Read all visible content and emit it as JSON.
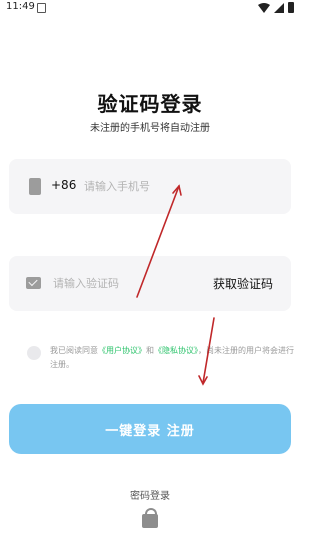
{
  "status_bar": {
    "time": "11:49"
  },
  "header": {
    "title": "验证码登录",
    "subtitle": "未注册的手机号将自动注册"
  },
  "phone_field": {
    "country_code": "+86",
    "placeholder": "请输入手机号",
    "value": ""
  },
  "code_field": {
    "placeholder": "请输入验证码",
    "value": "",
    "get_code_label": "获取验证码"
  },
  "agreement": {
    "checked": false,
    "prefix": "我已阅读同意",
    "user_agreement": "《用户协议》",
    "and": "和",
    "privacy_policy": "《隐私协议》",
    "suffix": "，尚未注册的用户将会进行注册。"
  },
  "login_button": {
    "label": "一键登录 注册"
  },
  "alt_login": {
    "label": "密码登录"
  },
  "colors": {
    "accent": "#78c6f1",
    "link": "#2cc36b",
    "annotation_arrow": "#c0282a"
  },
  "icons": [
    "phone-icon",
    "mail-icon",
    "lock-icon",
    "wifi-icon",
    "signal-icon",
    "battery-icon",
    "notification-icon"
  ]
}
